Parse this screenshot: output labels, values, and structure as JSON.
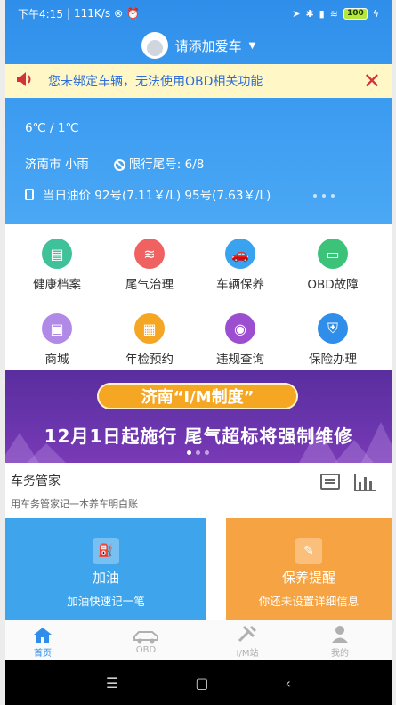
{
  "status": {
    "time": "下午4:15",
    "speed": "111K/s",
    "battery": "100"
  },
  "header": {
    "car_prompt": "请添加爱车"
  },
  "notice": {
    "text": "您未绑定车辆，无法使用OBD相关功能"
  },
  "weather": {
    "temp": "6℃ / 1℃",
    "city": "济南市 小雨",
    "restriction": "限行尾号: 6/8",
    "fuel": "当日油价 92号(7.11￥/L) 95号(7.63￥/L)"
  },
  "grid": [
    {
      "label": "健康档案",
      "color": "#3fc19a"
    },
    {
      "label": "尾气治理",
      "color": "#f06262"
    },
    {
      "label": "车辆保养",
      "color": "#3aa3f0"
    },
    {
      "label": "OBD故障",
      "color": "#3cc279"
    },
    {
      "label": "商城",
      "color": "#b08ae6"
    },
    {
      "label": "年检预约",
      "color": "#f5a623"
    },
    {
      "label": "违规查询",
      "color": "#9b4fd0"
    },
    {
      "label": "保险办理",
      "color": "#2f8ee9"
    }
  ],
  "banner": {
    "tag": "济南“I/M制度”",
    "headline": "12月1日起施行 尾气超标将强制维修"
  },
  "manager": {
    "title": "车务管家",
    "subtitle": "用车务管家记一本养车明白账",
    "cards": [
      {
        "title": "加油",
        "subtitle": "加油快速记一笔"
      },
      {
        "title": "保养提醒",
        "subtitle": "你还未设置详细信息"
      }
    ]
  },
  "tabs": [
    {
      "label": "首页"
    },
    {
      "label": "OBD"
    },
    {
      "label": "I/M站"
    },
    {
      "label": "我的"
    }
  ]
}
